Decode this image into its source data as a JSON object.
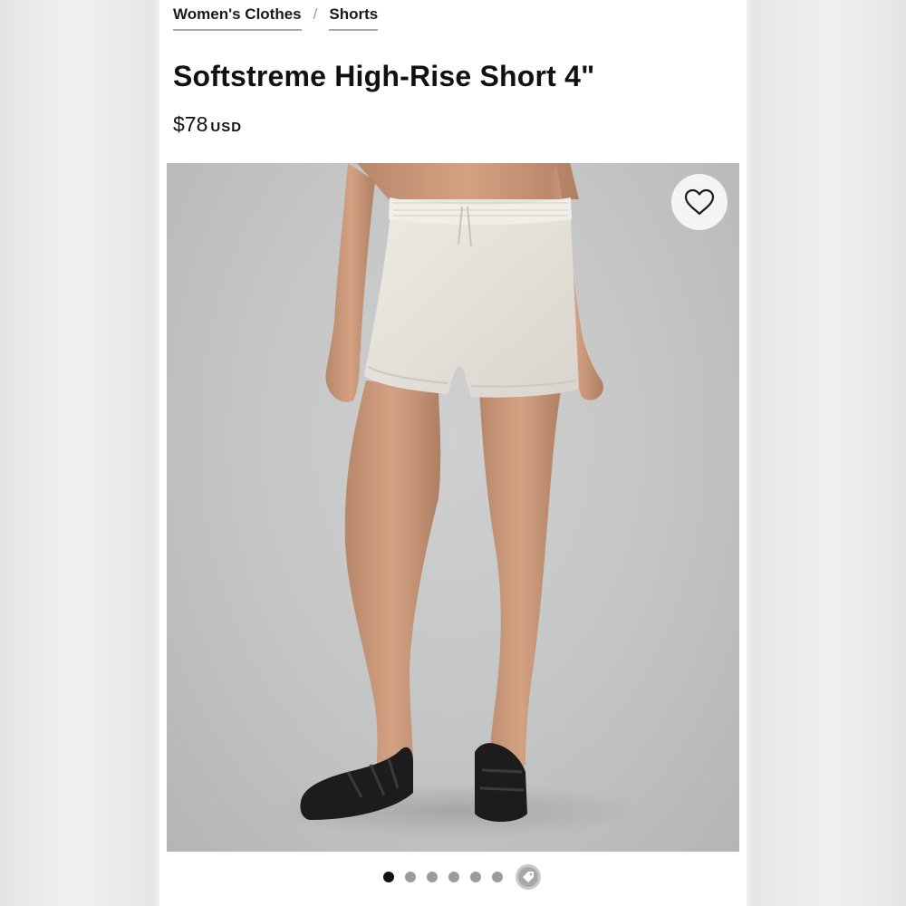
{
  "breadcrumb": {
    "items": [
      {
        "label": "Women's Clothes"
      },
      {
        "label": "Shorts"
      }
    ],
    "separator": "/"
  },
  "product": {
    "title": "Softstreme High-Rise Short 4\"",
    "price": "$78",
    "currency": "USD",
    "image": {
      "subject": "model wearing light beige high-rise shorts with black sandals",
      "background_color": "#c7c8c8",
      "shorts_color": "#e6e2da"
    }
  },
  "favorite": {
    "icon": "heart-outline-icon"
  },
  "carousel": {
    "dot_count": 6,
    "active_index": 0,
    "extra_icon": "tag-icon"
  },
  "colors": {
    "text": "#111111",
    "underline": "#a8a8a8",
    "dot_inactive": "#9b9b9b",
    "dot_active": "#111111"
  }
}
